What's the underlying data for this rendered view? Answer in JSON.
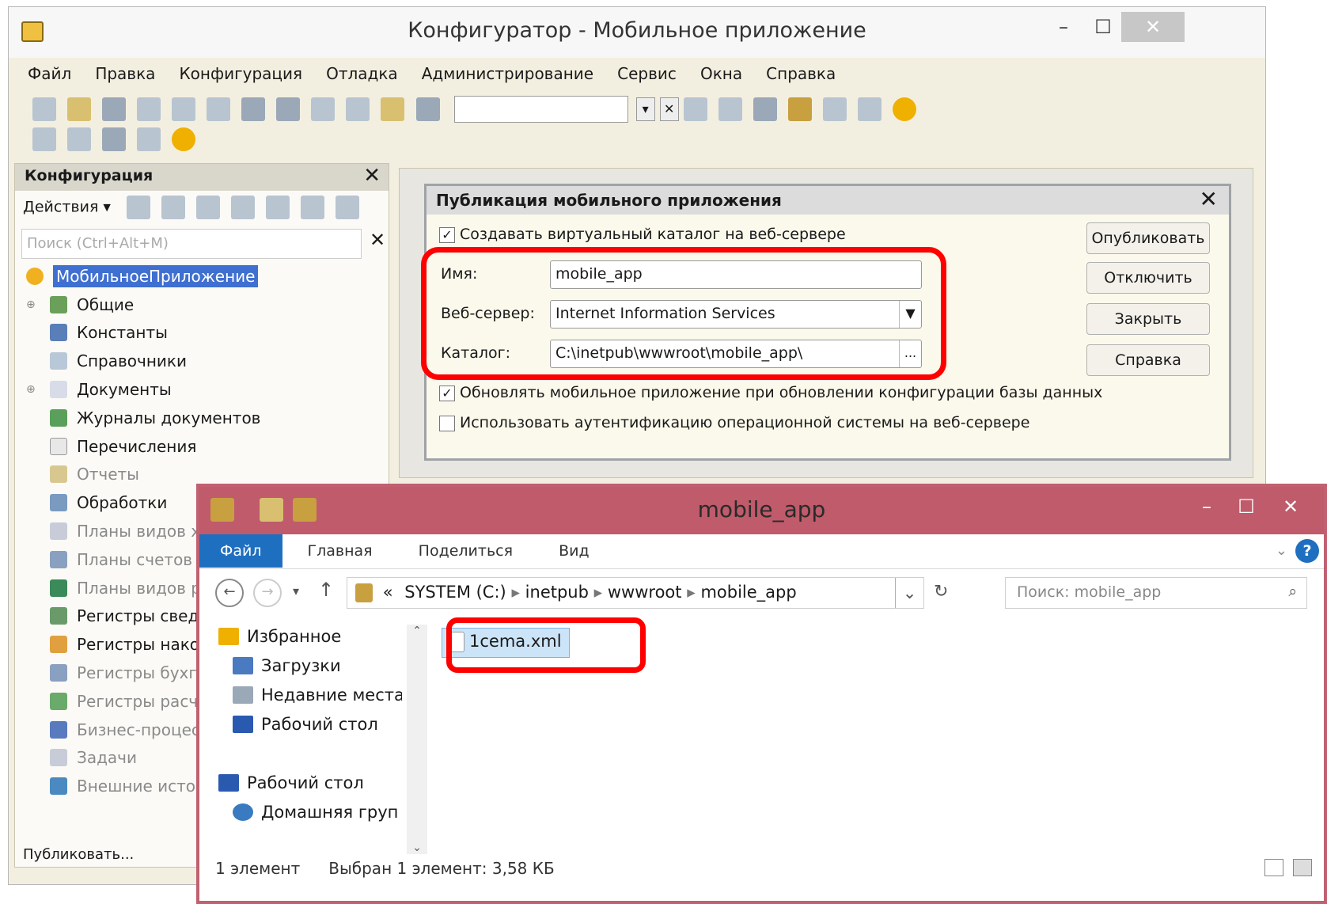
{
  "main": {
    "title": "Конфигуратор - Мобильное приложение",
    "menu": [
      "Файл",
      "Правка",
      "Конфигурация",
      "Отладка",
      "Администрирование",
      "Сервис",
      "Окна",
      "Справка"
    ],
    "minimize": "–",
    "maximize": "☐",
    "close": "✕"
  },
  "config_panel": {
    "header": "Конфигурация",
    "close": "✕",
    "actions": "Действия ▾",
    "search_placeholder": "Поиск (Ctrl+Alt+M)",
    "search_clear": "✕",
    "tree": [
      {
        "label": "МобильноеПриложение",
        "icon": "app-icon",
        "selected": true
      },
      {
        "label": "Общие",
        "icon": "common-icon",
        "expand": true
      },
      {
        "label": "Константы",
        "icon": "constants-icon"
      },
      {
        "label": "Справочники",
        "icon": "catalogs-icon"
      },
      {
        "label": "Документы",
        "icon": "documents-icon",
        "expand": true
      },
      {
        "label": "Журналы документов",
        "icon": "journals-icon"
      },
      {
        "label": "Перечисления",
        "icon": "enums-icon"
      },
      {
        "label": "Отчеты",
        "icon": "reports-icon",
        "dim": true
      },
      {
        "label": "Обработки",
        "icon": "dataprocessors-icon"
      },
      {
        "label": "Планы видов х",
        "icon": "chart-types-icon",
        "dim": true
      },
      {
        "label": "Планы счетов",
        "icon": "chart-accounts-icon",
        "dim": true
      },
      {
        "label": "Планы видов р",
        "icon": "calc-types-icon",
        "dim": true
      },
      {
        "label": "Регистры свед",
        "icon": "info-registers-icon"
      },
      {
        "label": "Регистры нако",
        "icon": "accum-registers-icon"
      },
      {
        "label": "Регистры бухг",
        "icon": "acct-registers-icon",
        "dim": true
      },
      {
        "label": "Регистры расч",
        "icon": "calc-registers-icon",
        "dim": true
      },
      {
        "label": "Бизнес-процес",
        "icon": "bp-icon",
        "dim": true
      },
      {
        "label": "Задачи",
        "icon": "tasks-icon",
        "dim": true
      },
      {
        "label": "Внешние источ",
        "icon": "ext-sources-icon",
        "dim": true
      }
    ],
    "status": "Публиковать..."
  },
  "dialog": {
    "title": "Публикация мобильного приложения",
    "close": "✕",
    "check_virtual": "Создавать виртуальный каталог на веб-сервере",
    "name_label": "Имя:",
    "name_value": "mobile_app",
    "server_label": "Веб-сервер:",
    "server_value": "Internet Information Services",
    "catalog_label": "Каталог:",
    "catalog_value": "C:\\inetpub\\wwwroot\\mobile_app\\",
    "browse": "...",
    "check_update": "Обновлять мобильное приложение при обновлении конфигурации базы данных",
    "check_auth": "Использовать аутентификацию операционной системы на веб-сервере",
    "buttons": [
      "Опубликовать",
      "Отключить",
      "Закрыть",
      "Справка"
    ]
  },
  "explorer": {
    "title": "mobile_app",
    "tabs": [
      "Файл",
      "Главная",
      "Поделиться",
      "Вид"
    ],
    "path": [
      "SYSTEM (C:)",
      "inetpub",
      "wwwroot",
      "mobile_app"
    ],
    "path_prefix": "«",
    "search_placeholder": "Поиск: mobile_app",
    "nav": [
      {
        "label": "Избранное",
        "icon": "star-icon",
        "indent": 0
      },
      {
        "label": "Загрузки",
        "icon": "downloads-icon",
        "indent": 1
      },
      {
        "label": "Недавние места",
        "icon": "recent-places-icon",
        "indent": 1
      },
      {
        "label": "Рабочий стол",
        "icon": "desktop-icon",
        "indent": 1
      },
      {
        "label": "",
        "icon": "",
        "indent": 0
      },
      {
        "label": "Рабочий стол",
        "icon": "desktop-icon",
        "indent": 0
      },
      {
        "label": "Домашняя груп",
        "icon": "homegroup-icon",
        "indent": 1
      }
    ],
    "file": "1cema.xml",
    "status_count": "1 элемент",
    "status_selected": "Выбран 1 элемент: 3,58 КБ",
    "minimize": "–",
    "maximize": "☐",
    "close": "✕",
    "help": "?"
  },
  "colors": {
    "highlight": "#ff0000",
    "explorer_title": "#bf5b6b",
    "selection": "#3f6fd0"
  }
}
